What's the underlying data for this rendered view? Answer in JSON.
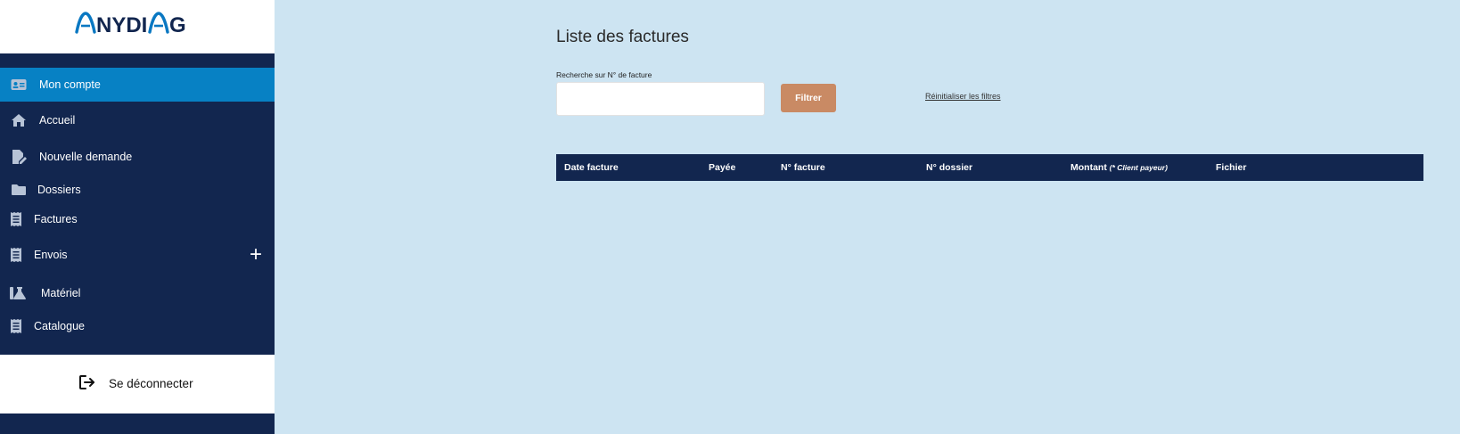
{
  "brand": {
    "logo_text": "ANYDIAG"
  },
  "sidebar": {
    "items": [
      {
        "label": "Mon compte",
        "icon": "id-card-icon",
        "active": true
      },
      {
        "label": "Accueil",
        "icon": "home-icon"
      },
      {
        "label": "Nouvelle demande",
        "icon": "file-edit-icon"
      },
      {
        "label": "Dossiers",
        "icon": "folder-icon"
      },
      {
        "label": "Factures",
        "icon": "receipt-icon"
      },
      {
        "label": "Envois",
        "icon": "receipt-icon",
        "expand": "+"
      },
      {
        "label": "Matériel",
        "icon": "flask-icon"
      },
      {
        "label": "Catalogue",
        "icon": "receipt-icon"
      }
    ],
    "logout_label": "Se déconnecter"
  },
  "main": {
    "title": "Liste des factures",
    "search": {
      "label": "Recherche sur N° de facture",
      "value": "",
      "placeholder": ""
    },
    "filter_button": "Filtrer",
    "reset_link": "Réinitialiser les filtres",
    "table": {
      "columns": [
        "Date facture",
        "Payée",
        "N° facture",
        "N° dossier",
        "Montant",
        "Fichier"
      ],
      "montant_note": "(* Client payeur)",
      "rows": []
    }
  },
  "colors": {
    "sidebar_bg": "#12264f",
    "active_item": "#0781c4",
    "content_bg": "#cde4f2",
    "filter_button": "#c98a64",
    "logo_blue": "#0a78c2",
    "logo_navy": "#12264f"
  }
}
